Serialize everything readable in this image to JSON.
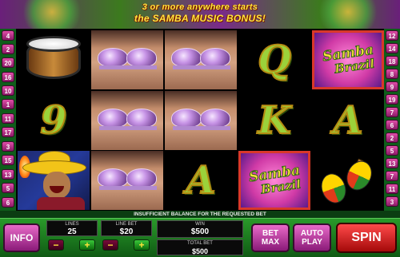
{
  "banner": {
    "line1": "3 or more  anywhere starts",
    "line2": "the SAMBA MUSIC BONUS!"
  },
  "paylines": {
    "left": [
      "4",
      "2",
      "20",
      "16",
      "10",
      "1",
      "11",
      "17",
      "3",
      "15",
      "13",
      "5",
      "6"
    ],
    "right": [
      "12",
      "14",
      "18",
      "8",
      "9",
      "19",
      "7",
      "6",
      "2",
      "5",
      "13",
      "7",
      "11",
      "3"
    ]
  },
  "reels": {
    "symbols": [
      [
        "drum",
        "dancer",
        "dancer",
        "Q",
        "samba-brazil"
      ],
      [
        "9",
        "dancer",
        "dancer",
        "K",
        "A"
      ],
      [
        "sombrero-man",
        "dancer",
        "A",
        "samba-brazil",
        "maracas"
      ]
    ],
    "letters": {
      "q": "Q",
      "nine": "9",
      "k": "K",
      "a1": "A",
      "a2": "A"
    },
    "logo_word1": "Samba",
    "logo_word2": "Brazil"
  },
  "message": "INSUFFICIENT BALANCE FOR THE REQUESTED BET",
  "controls": {
    "info_label": "INFO",
    "lines_label": "LINES",
    "lines_value": "25",
    "line_bet_label": "LINE BET",
    "line_bet_value": "$20",
    "win_label": "WIN",
    "win_value": "$500",
    "total_bet_label": "TOTAL BET",
    "total_bet_value": "$500",
    "bet_max_label": "BET MAX",
    "auto_play_label": "AUTO PLAY",
    "spin_label": "SPIN",
    "minus": "−",
    "plus": "+"
  },
  "colors": {
    "accent_pink": "#e86ac8",
    "spin_red": "#d61a1a",
    "win_frame": "#d9382a",
    "panel_green": "#1e8a1e"
  }
}
